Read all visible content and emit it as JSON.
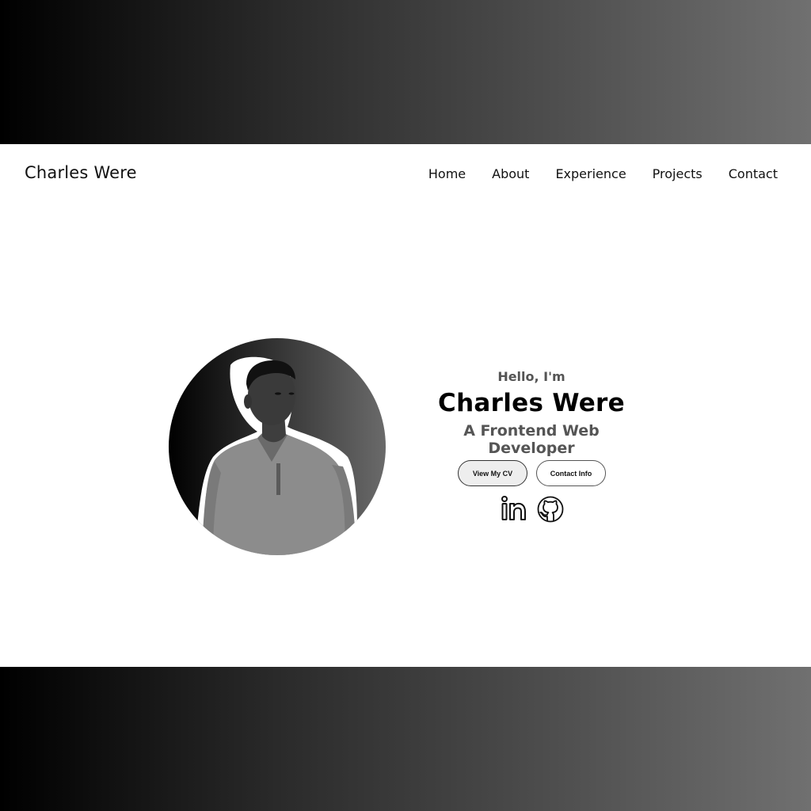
{
  "brand": {
    "name": "Charles Were"
  },
  "nav": {
    "items": [
      "Home",
      "About",
      "Experience",
      "Projects",
      "Contact"
    ]
  },
  "hero": {
    "greeting": "Hello, I'm",
    "name": "Charles Were",
    "role": "A Frontend Web Developer",
    "buttons": {
      "cv": "View My CV",
      "contact": "Contact Info"
    },
    "socials": [
      "linkedin-icon",
      "github-icon"
    ]
  },
  "colors": {
    "text": "#111111",
    "muted": "#555555",
    "band_start": "#000000",
    "band_end": "#707070"
  }
}
